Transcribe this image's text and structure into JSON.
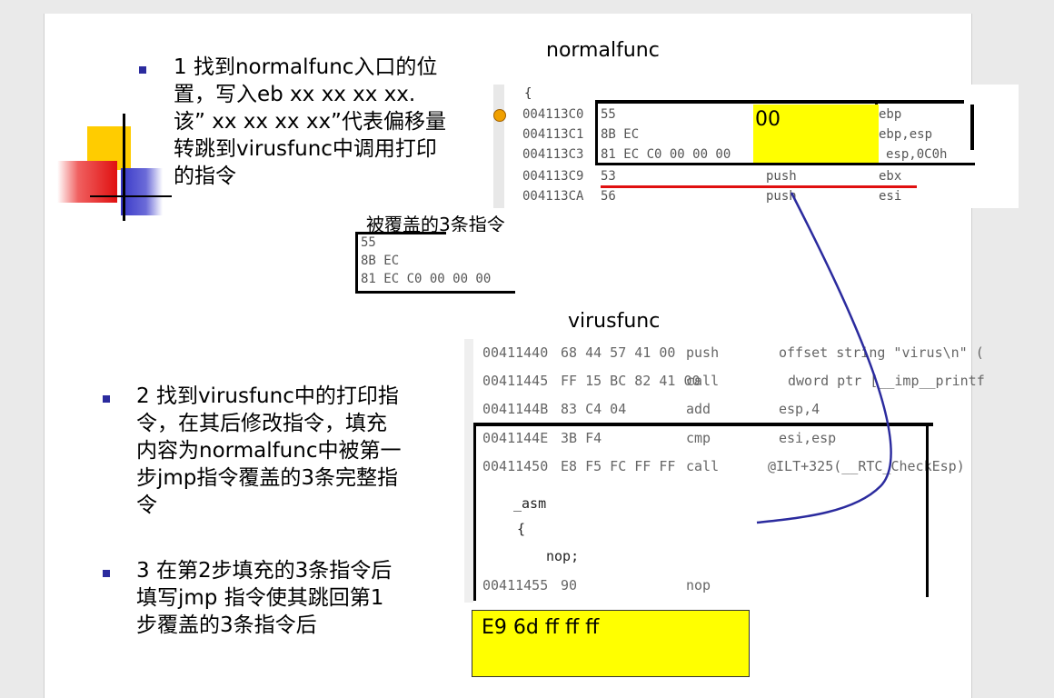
{
  "step1": {
    "lines": [
      "1 找到normalfunc入口的位",
      "置，写入eb xx xx xx xx.",
      "该” xx xx xx xx”代表偏移量",
      "转跳到virusfunc中调用打印",
      "的指令"
    ]
  },
  "step2": {
    "lines": [
      "2 找到virusfunc中的打印指",
      "令，在其后修改指令，填充",
      "内容为normalfunc中被第一",
      "步jmp指令覆盖的3条完整指",
      "令"
    ]
  },
  "step3": {
    "lines": [
      "3 在第2步填充的3条指令后",
      "填写jmp 指令使其跳回第1",
      "步覆盖的3条指令后"
    ]
  },
  "normalfunc": {
    "title": "normalfunc",
    "brace": "{",
    "rows": [
      {
        "addr": "004113C0",
        "bytes": "55",
        "op": "",
        "arg": "ebp"
      },
      {
        "addr": "004113C1",
        "bytes": "8B EC",
        "op": "",
        "arg": "ebp,esp"
      },
      {
        "addr": "004113C3",
        "bytes": "81 EC C0 00 00 00",
        "op": "",
        "arg": "esp,0C0h"
      },
      {
        "addr": "004113C9",
        "bytes": "53",
        "op": "push",
        "arg": "ebx"
      },
      {
        "addr": "004113CA",
        "bytes": "56",
        "op": "push",
        "arg": "esi"
      }
    ],
    "patch_text": "00"
  },
  "covered": {
    "title": "被覆盖的3条指令",
    "rows": [
      "55",
      "8B EC",
      "81 EC C0 00 00 00"
    ]
  },
  "virusfunc": {
    "title": "virusfunc",
    "rows": [
      {
        "addr": "00411440",
        "bytes": "68 44 57 41 00",
        "op": "push",
        "arg": "offset string \"virus\\n\" ("
      },
      {
        "addr": "00411445",
        "bytes": "FF 15 BC 82 41 00",
        "op": "call",
        "arg": "dword ptr [__imp__printf"
      },
      {
        "addr": "0041144B",
        "bytes": "83 C4 04",
        "op": "add",
        "arg": "esp,4"
      },
      {
        "addr": "0041144E",
        "bytes": "3B F4",
        "op": "cmp",
        "arg": "esi,esp"
      },
      {
        "addr": "00411450",
        "bytes": "E8 F5 FC FF FF",
        "op": "call",
        "arg": "@ILT+325(__RTC_CheckEsp)"
      }
    ],
    "asm_lines": [
      "_asm",
      "{",
      "nop;"
    ],
    "nop_row": {
      "addr": "00411455",
      "bytes": "90",
      "op": "nop",
      "arg": ""
    }
  },
  "jmp_box": {
    "text": "E9 6d ff ff ff"
  },
  "colors": {
    "highlight": "#ffff00",
    "bullet": "#2b2b9e",
    "arrow": "#2b2b9e",
    "red_line": "#e01010"
  }
}
